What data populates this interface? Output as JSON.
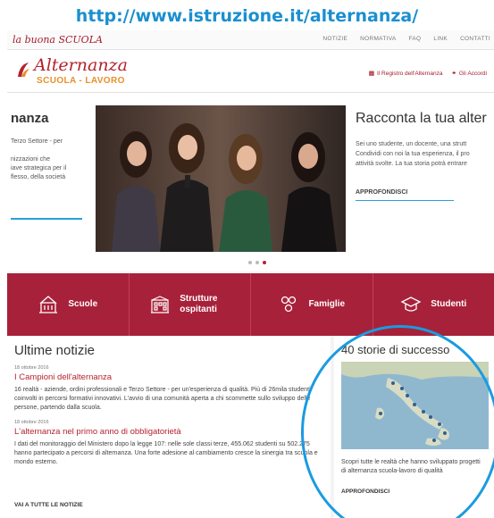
{
  "banner_url": "http://www.istruzione.it/alternanza/",
  "topbar": {
    "brand": "la buona SCUOLA",
    "nav": [
      "NOTIZIE",
      "NORMATIVA",
      "FAQ",
      "LINK",
      "CONTATTI"
    ]
  },
  "header": {
    "logo_title": "Alternanza",
    "logo_subtitle": "SCUOLA - LAVORO",
    "links": [
      {
        "icon": "register-icon",
        "label": "Il Registro dell'Alternanza"
      },
      {
        "icon": "link-icon",
        "label": "Gli Accordi"
      }
    ]
  },
  "hero": {
    "left_title": "nanza",
    "left_text_1": "Terzo Settore - per",
    "left_text_2": "nizzazioni che",
    "left_text_3": "iave strategica per il",
    "left_text_4": "flesso, della società",
    "right_title": "Racconta la tua alter",
    "right_text_1": "Sei uno studente, un docente, una strutt",
    "right_text_2": "Condividi con noi la tua esperienza, il pro",
    "right_text_3": "attività svolte. La tua storia potrà entrare",
    "right_link": "APPROFONDISCI",
    "dots": 3,
    "active_dot": 3
  },
  "categories": [
    {
      "icon": "school-building-icon",
      "label": "Scuole"
    },
    {
      "icon": "host-structure-icon",
      "label": "Strutture ospitanti"
    },
    {
      "icon": "family-icon",
      "label": "Famiglie"
    },
    {
      "icon": "students-icon",
      "label": "Studenti"
    }
  ],
  "news": {
    "heading": "Ultime notizie",
    "items": [
      {
        "date": "18 ottobre 2016",
        "title": "I Campioni dell'alternanza",
        "text": "16 realtà - aziende, ordini professionali e Terzo Settore - per un'esperienza di qualità. Più di 26mila studenti coinvolti in percorsi formativi innovativi. L'avvio di una comunità aperta a chi scommette sullo sviluppo delle persone, partendo dalla scuola."
      },
      {
        "date": "18 ottobre 2016",
        "title": "L'alternanza nel primo anno di obbligatorietà",
        "text": "I dati del monitoraggio del Ministero dopo la legge 107: nelle sole classi terze, 455.062 studenti su 502.275 hanno partecipato a percorsi di alternanza. Una forte adesione al cambiamento cresce la sinergia tra scuola e mondo esterno."
      }
    ],
    "all_link": "VAI A TUTTE LE NOTIZIE"
  },
  "success": {
    "heading": "40 storie di successo",
    "text": "Scopri tutte le realtà che hanno sviluppato progetti di alternanza scuola-lavoro di qualità",
    "link": "APPROFONDISCI"
  },
  "colors": {
    "accent_red": "#a8213a",
    "link_blue": "#1a8fd0",
    "highlight_circle": "#1a9be0",
    "logo_orange": "#e8902a"
  }
}
